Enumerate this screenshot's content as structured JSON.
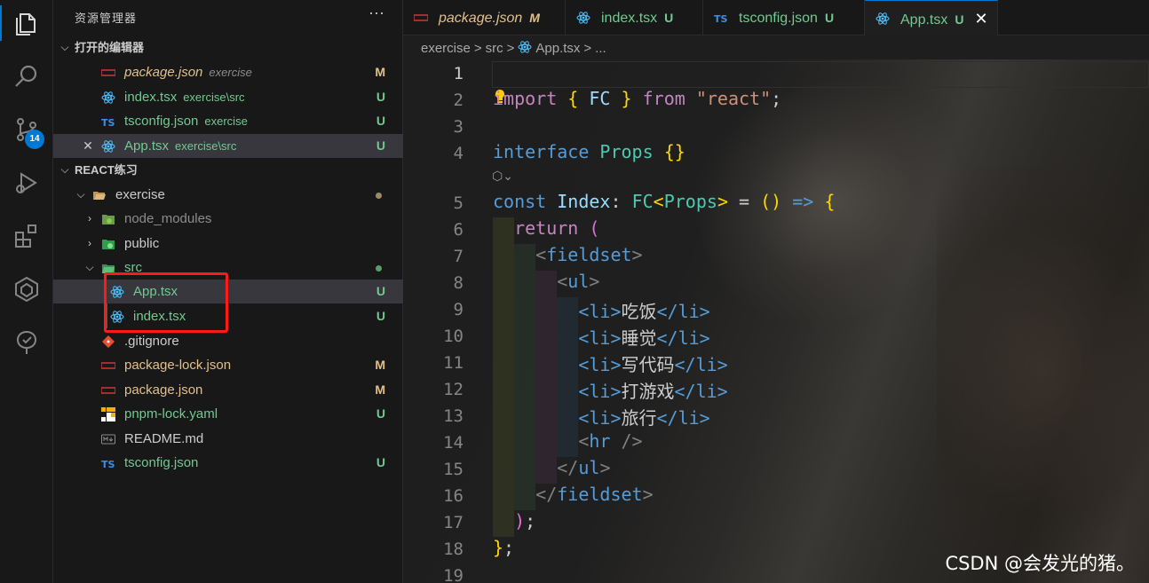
{
  "sidebar": {
    "title": "资源管理器",
    "more": "···",
    "open_editors": {
      "header": "打开的编辑器",
      "items": [
        {
          "name": "package.json",
          "path": "exercise",
          "status": "M",
          "close": ""
        },
        {
          "name": "index.tsx",
          "path": "exercise\\src",
          "status": "U",
          "close": ""
        },
        {
          "name": "tsconfig.json",
          "path": "exercise",
          "status": "U",
          "close": ""
        },
        {
          "name": "App.tsx",
          "path": "exercise\\src",
          "status": "U",
          "close": "✕"
        }
      ]
    },
    "workspace": {
      "header": "REACT练习",
      "items": [
        {
          "name": "exercise",
          "status": ""
        },
        {
          "name": "node_modules",
          "status": ""
        },
        {
          "name": "public",
          "status": ""
        },
        {
          "name": "src",
          "status": ""
        },
        {
          "name": "App.tsx",
          "status": "U"
        },
        {
          "name": "index.tsx",
          "status": "U"
        },
        {
          "name": ".gitignore",
          "status": ""
        },
        {
          "name": "package-lock.json",
          "status": "M"
        },
        {
          "name": "package.json",
          "status": "M"
        },
        {
          "name": "pnpm-lock.yaml",
          "status": "U"
        },
        {
          "name": "README.md",
          "status": ""
        },
        {
          "name": "tsconfig.json",
          "status": "U"
        }
      ]
    }
  },
  "activity": {
    "source_control_badge": "14"
  },
  "tabs": [
    {
      "name": "package.json",
      "status": "M"
    },
    {
      "name": "index.tsx",
      "status": "U"
    },
    {
      "name": "tsconfig.json",
      "status": "U"
    },
    {
      "name": "App.tsx",
      "status": "U",
      "close": "✕"
    }
  ],
  "breadcrumb": {
    "segments": [
      "exercise",
      ">",
      "src",
      ">",
      "App.tsx",
      ">",
      "..."
    ]
  },
  "editor": {
    "line_numbers": [
      "1",
      "2",
      "3",
      "4",
      "5",
      "6",
      "7",
      "8",
      "9",
      "10",
      "11",
      "12",
      "13",
      "14",
      "15",
      "16",
      "17",
      "18",
      "19"
    ],
    "lines": {
      "l2": {
        "kw": "import",
        "b1": "{",
        "id": "FC",
        "b2": "}",
        "from": "from",
        "str": "\"react\"",
        "semi": ";"
      },
      "l4": {
        "kw": "interface",
        "id": "Props",
        "br": "{}"
      },
      "l5": {
        "kw": "const",
        "id": "Index",
        "colon": ":",
        "ty": "FC",
        "lt": "<",
        "ty2": "Props",
        "gt": ">",
        "eq": "=",
        "p": "()",
        "arrow": "=>",
        "b": "{"
      },
      "l6": {
        "kw": "return",
        "p": "("
      },
      "l7": {
        "open": "<",
        "tag": "fieldset",
        "close": ">"
      },
      "l8": {
        "open": "<",
        "tag": "ul",
        "close": ">"
      },
      "items": [
        "吃饭",
        "睡觉",
        "写代码",
        "打游戏",
        "旅行"
      ],
      "li_open": "<li>",
      "li_close": "</li>",
      "l14": {
        "open": "<",
        "tag": "hr",
        "close": " />"
      },
      "l15": {
        "open": "</",
        "tag": "ul",
        "close": ">"
      },
      "l16": {
        "open": "</",
        "tag": "fieldset",
        "close": ">"
      },
      "l17": {
        "p": ")",
        "semi": ";"
      },
      "l18": {
        "b": "}",
        "semi": ";"
      }
    }
  },
  "watermark": "CSDN @会发光的猪。",
  "colors": {
    "accent": "#0078d4",
    "untracked": "#73c991",
    "modified": "#e2c08d",
    "highlight_box": "#ff1a1a"
  }
}
